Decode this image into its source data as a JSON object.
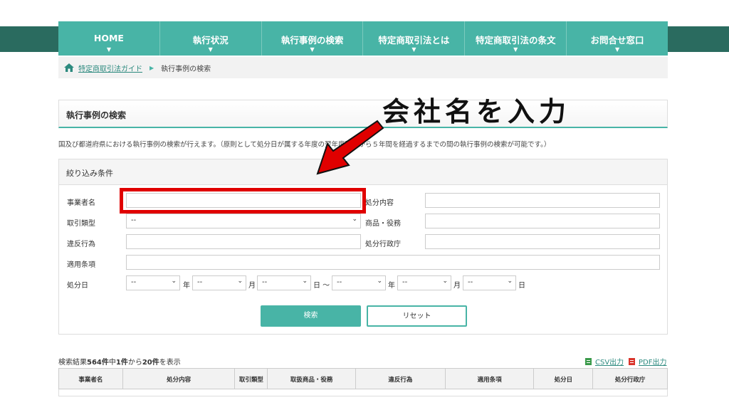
{
  "nav": {
    "items": [
      {
        "label": "HOME"
      },
      {
        "label": "執行状況"
      },
      {
        "label": "執行事例の検索"
      },
      {
        "label": "特定商取引法とは"
      },
      {
        "label": "特定商取引法の条文"
      },
      {
        "label": "お問合せ窓口"
      }
    ],
    "arrow": "▼"
  },
  "breadcrumb": {
    "home_link": "特定商取引法ガイド",
    "separator": "▶",
    "current": "執行事例の検索"
  },
  "page_title": "執行事例の検索",
  "description": "国及び都道府県における執行事例の検索が行えます。（原則として処分日が属する年度の翌年度開始から５年間を経過するまでの間の執行事例の検索が可能です。）",
  "filter": {
    "heading": "絞り込み条件",
    "fields": {
      "business_name": {
        "label": "事業者名",
        "value": ""
      },
      "disposition_content": {
        "label": "処分内容",
        "value": ""
      },
      "transaction_type": {
        "label": "取引類型",
        "value": "--"
      },
      "product_service": {
        "label": "商品・役務",
        "value": ""
      },
      "violation": {
        "label": "違反行為",
        "value": ""
      },
      "agency": {
        "label": "処分行政庁",
        "value": ""
      },
      "article": {
        "label": "適用条項",
        "value": ""
      },
      "date": {
        "label": "処分日"
      }
    },
    "date_selects": {
      "from_year": "--",
      "from_month": "--",
      "from_day": "--",
      "to_year": "--",
      "to_month": "--",
      "to_day": "--"
    },
    "units": {
      "year": "年",
      "month": "月",
      "day_from": "日 〜",
      "day": "日"
    },
    "search_button": "検索",
    "reset_button": "リセット"
  },
  "annotation": {
    "text": "会社名を入力"
  },
  "results": {
    "prefix": "検索結果",
    "total": "564件",
    "mid1": "中",
    "from": "1件",
    "mid2": "から",
    "to": "20件",
    "suffix": "を表示",
    "csv_label": "CSV出力",
    "pdf_label": "PDF出力",
    "columns": [
      "事業者名",
      "処分内容",
      "取引類型",
      "取扱商品・役務",
      "違反行為",
      "適用条項",
      "処分日",
      "処分行政庁"
    ]
  },
  "colors": {
    "accent": "#48b4a6",
    "dark_band": "#2a6b5f",
    "highlight": "#e00000"
  }
}
